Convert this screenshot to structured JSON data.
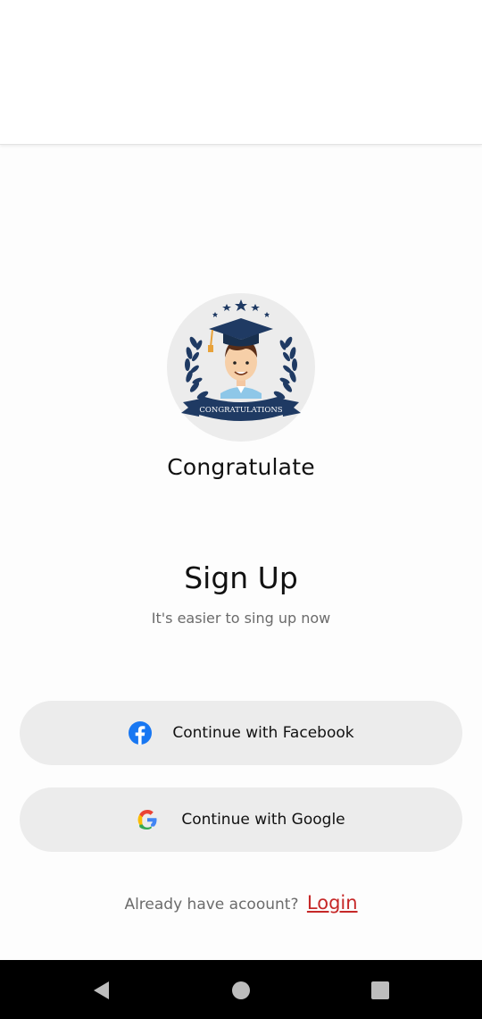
{
  "app": {
    "name": "Congratulate"
  },
  "logo": {
    "banner_text": "CONGRATULATIONS",
    "icon": "graduate-badge-icon"
  },
  "signup": {
    "heading": "Sign Up",
    "subheading": "It's easier to sing up now",
    "facebook_label": "Continue with Facebook",
    "google_label": "Continue with Google"
  },
  "login": {
    "prompt": "Already have acoount?",
    "link_label": "Login"
  },
  "colors": {
    "facebook": "#1877F2",
    "login_link": "#C62828",
    "button_bg": "#ECECEC",
    "logo_navy": "#1F3A63"
  },
  "navbar": {
    "back_icon": "back-triangle-icon",
    "home_icon": "home-circle-icon",
    "recents_icon": "recents-square-icon"
  }
}
